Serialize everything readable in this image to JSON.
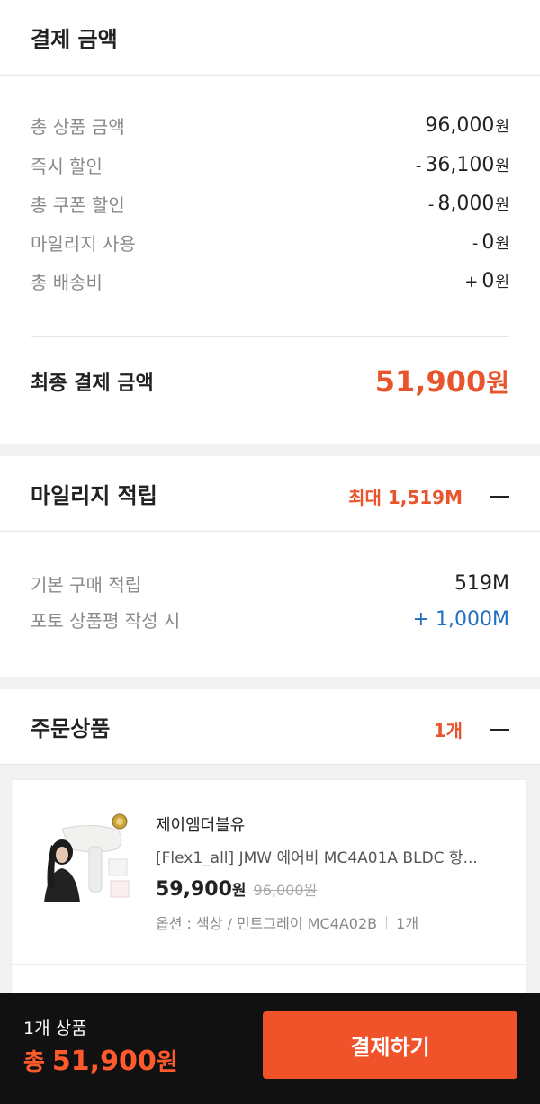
{
  "payment": {
    "title": "결제 금액",
    "rows": [
      {
        "label": "총 상품 금액",
        "sign": "",
        "amount": "96,000",
        "unit": "원"
      },
      {
        "label": "즉시 할인",
        "sign": "-",
        "amount": "36,100",
        "unit": "원"
      },
      {
        "label": "총 쿠폰 할인",
        "sign": "-",
        "amount": "8,000",
        "unit": "원"
      },
      {
        "label": "마일리지 사용",
        "sign": "-",
        "amount": "0",
        "unit": "원"
      },
      {
        "label": "총 배송비",
        "sign": "+",
        "amount": "0",
        "unit": "원"
      }
    ],
    "final_label": "최종 결제 금액",
    "final_amount": "51,900",
    "final_unit": "원"
  },
  "mileage": {
    "title": "마일리지 적립",
    "max_label": "최대 1,519M",
    "rows": [
      {
        "label": "기본 구매 적립",
        "value": "519M"
      },
      {
        "label": "포토 상품평 작성 시",
        "value": "+ 1,000M"
      }
    ]
  },
  "order": {
    "title": "주문상품",
    "count": "1개",
    "item": {
      "brand": "제이엠더블유",
      "name": "[Flex1_all] JMW 에어비 MC4A01A BLDC 항...",
      "price": "59,900",
      "price_unit": "원",
      "original_price": "96,000원",
      "option": "옵션 : 색상 / 민트그레이 MC4A02B",
      "quantity": "1개"
    }
  },
  "bottom_bar": {
    "count_label": "1개 상품",
    "total_prefix": "총",
    "total_amount": "51,900",
    "total_unit": "원",
    "pay_button": "결제하기"
  },
  "colors": {
    "accent": "#e8542c",
    "blue": "#1f6fc2",
    "button": "#f0532a"
  }
}
